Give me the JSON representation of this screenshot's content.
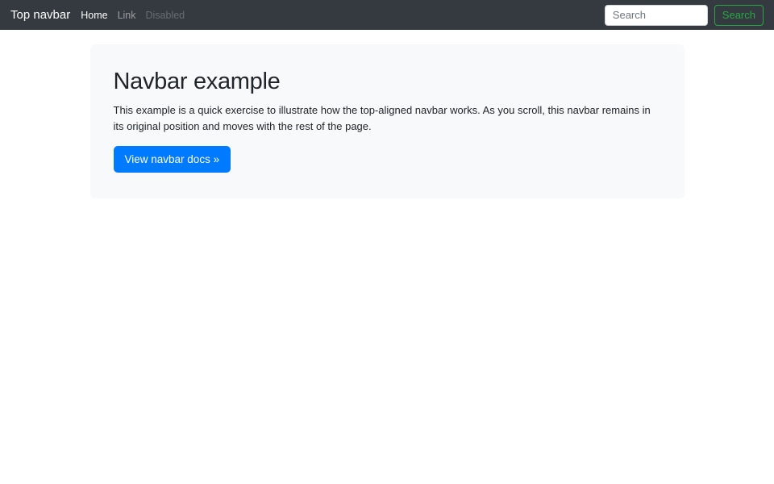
{
  "navbar": {
    "brand": "Top navbar",
    "links": [
      {
        "label": "Home",
        "state": "active"
      },
      {
        "label": "Link",
        "state": "default"
      },
      {
        "label": "Disabled",
        "state": "disabled"
      }
    ],
    "search": {
      "placeholder": "Search",
      "value": "",
      "button_label": "Search"
    }
  },
  "jumbotron": {
    "title": "Navbar example",
    "description": "This example is a quick exercise to illustrate how the top-aligned navbar works. As you scroll, this navbar remains in its original position and moves with the rest of the page.",
    "cta_label": "View navbar docs »"
  },
  "colors": {
    "navbar_bg": "#343a40",
    "navbar_text": "#ffffff",
    "primary": "#007bff",
    "success_outline": "#28a745",
    "jumbotron_bg": "#f8f9fa",
    "body_text": "#212529",
    "page_bg": "#ffffff"
  }
}
